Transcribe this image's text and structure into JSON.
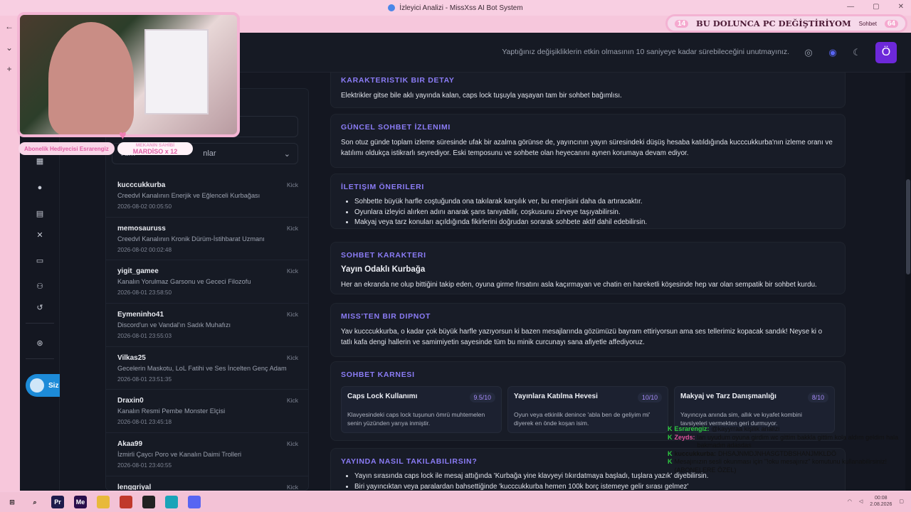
{
  "window": {
    "title": "İzleyici Analizi - MissXss AI Bot System"
  },
  "topbar": {
    "notice": "Yaptığınız değişikliklerin etkin olmasının 10 saniyeye kadar sürebileceğini unutmayınız.",
    "avatar_letter": "Ö"
  },
  "rail": {
    "user_label": "Siz"
  },
  "viewer_panel": {
    "filter_label": "Tüm",
    "filter_label_right": "nlar",
    "viewers": [
      {
        "name": "kucccukkurba",
        "platform": "Kick",
        "title": "Creedvl Kanalının Enerjik ve Eğlenceli Kurbağası",
        "date": "2026-08-02 00:05:50"
      },
      {
        "name": "memosauruss",
        "platform": "Kick",
        "title": "Creedvl Kanalının Kronik Dürüm-İstihbarat Uzmanı",
        "date": "2026-08-02 00:02:48"
      },
      {
        "name": "yigit_gameе",
        "platform": "Kick",
        "title": "Kanalın Yorulmaz Garsonu ve Gececi Filozofu",
        "date": "2026-08-01 23:58:50"
      },
      {
        "name": "Eymeninho41",
        "platform": "Kick",
        "title": "Discord'un ve Vandal'ın Sadık Muhafızı",
        "date": "2026-08-01 23:55:03"
      },
      {
        "name": "Vilkas25",
        "platform": "Kick",
        "title": "Gecelerin Maskotu, LoL Fatihi ve Ses İncelten Genç Adam",
        "date": "2026-08-01 23:51:35"
      },
      {
        "name": "Draxin0",
        "platform": "Kick",
        "title": "Kanalın Resmi Pembe Monster Elçisi",
        "date": "2026-08-01 23:45:18"
      },
      {
        "name": "Akaa99",
        "platform": "Kick",
        "title": "İzmirli Çaycı Poro ve Kanalın Daimi Trolleri",
        "date": "2026-08-01 23:40:55"
      },
      {
        "name": "lenggriyal",
        "platform": "Kick",
        "title": "",
        "date": ""
      }
    ]
  },
  "analysis": {
    "detail": {
      "heading": "KARAKTERISTIK BIR DETAY",
      "text": "Elektrikler gitse bile aklı yayında kalan, caps lock tuşuyla yaşayan tam bir sohbet bağımlısı."
    },
    "current": {
      "heading": "GÜNCEL SOHBET İZLENIMI",
      "text": "Son otuz günde toplam izleme süresinde ufak bir azalma görünse de, yayıncının yayın süresindeki düşüş hesaba katıldığında kucccukkurba'nın izleme oranı ve katılımı oldukça istikrarlı seyrediyor. Eski temposunu ve sohbete olan heyecanını aynen korumaya devam ediyor."
    },
    "tips": {
      "heading": "İLETIŞIM ÖNERILERI",
      "items": [
        "Sohbette büyük harfle coştuğunda ona takılarak karşılık ver, bu enerjisini daha da artıracaktır.",
        "Oyunlara izleyici alırken adını anarak şans tanıyabilir, coşkusunu zirveye taşıyabilirsin.",
        "Makyaj veya tarz konuları açıldığında fikirlerini doğrudan sorarak sohbete aktif dahil edebilirsin."
      ]
    },
    "character": {
      "heading": "SOHBET KARAKTERI",
      "subtitle": "Yayın Odaklı Kurbağa",
      "text": "Her an ekranda ne olup bittiğini takip eden, oyuna girme fırsatını asla kaçırmayan ve chatin en hareketli köşesinde hep var olan sempatik bir sohbet kurdu."
    },
    "footnote": {
      "heading": "MISS'TEN BIR DIPNOT",
      "text": "Yav kucccukkurba, o kadar çok büyük harfle yazıyorsun ki bazen mesajlarında gözümüzü bayram ettiriyorsun ama ses tellerimiz kopacak sandık! Neyse ki o tatlı kafa dengi hallerin ve samimiyetin sayesinde tüm bu minik curcunayı sana afiyetle affediyoruz."
    },
    "report": {
      "heading": "SOHBET KARNESI",
      "scores": [
        {
          "name": "Caps Lock Kullanımı",
          "value": "9.5/10",
          "desc": "Klavyesindeki caps lock tuşunun ömrü muhtemelen senin yüzünden yarıya inmiştir."
        },
        {
          "name": "Yayınlara Katılma Hevesi",
          "value": "10/10",
          "desc": "Oyun veya etkinlik denince 'abla ben de geliyim mi' diyerek en önde koşan isim."
        },
        {
          "name": "Makyaj ve Tarz Danışmanlığı",
          "value": "8/10",
          "desc": "Yayıncıya anında sim, allık ve kıyafet kombini tavsiyeleri vermekten geri durmuyor."
        }
      ]
    },
    "hooks": {
      "heading": "YAYINDA NASIL TAKILABILIRSIN?",
      "items": [
        "Yayın sırasında caps lock ile mesaj attığında 'Kurbağa yine klavyeyi tıkırdatmaya başladı, tuşlara yazık' diyebilirsin.",
        "Biri yayıncıktan veya paralardan bahsettiğinde 'kucccukkurba hemen 100k borç istemeye gelir sırası gelmez'"
      ]
    }
  },
  "overlay": {
    "pill_left": "Abonelik Hediyecisi Esrarengiz",
    "pill_small": "MEKANIN SAHİBİ",
    "pill_main": "MARDİSO x 12",
    "goal_left": "14",
    "goal_text": "BU DOLUNCA PC DEĞİŞTİRİYOM",
    "goal_tag": "Sohbet",
    "goal_right": "64"
  },
  "chat": [
    {
      "who": "Esrarengiz:",
      "msg": "@kayyrraa kişilik analizi",
      "color": "#2ecc40"
    },
    {
      "who": "Zeyds:",
      "msg": "lan uyudum oyuna girdim wc gittim bakkla gittim kola aldım geldim hala bakmadın adasdas",
      "color": "#e0529c"
    },
    {
      "who": "kuccukkurba:",
      "msg": "DHSAJNMDJNHASGTDBSHANJMKLDÖ",
      "color": "#111111"
    },
    {
      "who": "",
      "msg": "Mesajınızın sesli okunması için \"!oku mesajınız\" komutunu kullanabilirsiniz! (ABONELERE ÖZEL)",
      "color": "#111111"
    }
  ],
  "taskbar": {
    "time": "00:08",
    "date": "2.08.2026"
  }
}
